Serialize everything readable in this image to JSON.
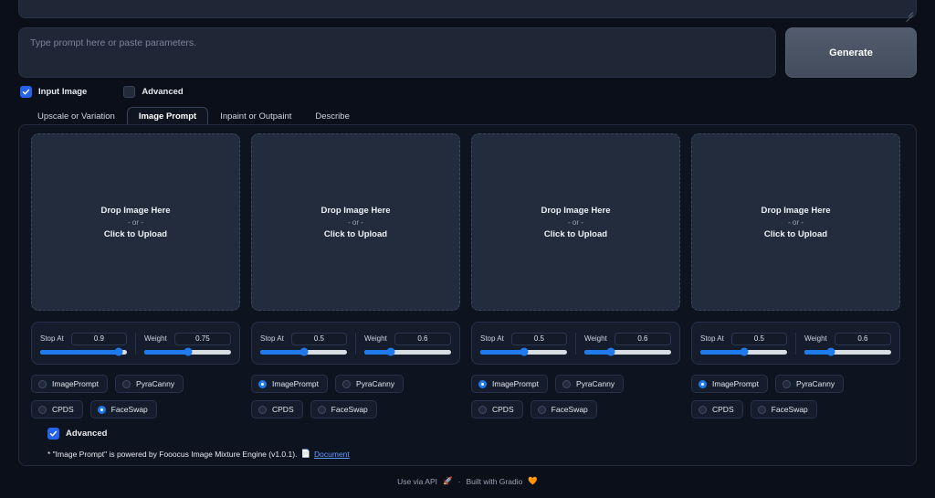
{
  "prompt": {
    "placeholder": "Type prompt here or paste parameters.",
    "value": ""
  },
  "generate_label": "Generate",
  "checkboxes": {
    "input_image": "Input Image",
    "advanced": "Advanced"
  },
  "tabs": [
    {
      "label": "Upscale or Variation",
      "active": false
    },
    {
      "label": "Image Prompt",
      "active": true
    },
    {
      "label": "Inpaint or Outpaint",
      "active": false
    },
    {
      "label": "Describe",
      "active": false
    }
  ],
  "dropzone": {
    "main": "Drop Image Here",
    "or": "- or -",
    "upload": "Click to Upload"
  },
  "slider_labels": {
    "stop_at": "Stop At",
    "weight": "Weight"
  },
  "radio_labels": {
    "image_prompt": "ImagePrompt",
    "pyra_canny": "PyraCanny",
    "cpds": "CPDS",
    "face_swap": "FaceSwap"
  },
  "columns": [
    {
      "stop_at": "0.9",
      "stop_at_pct": 90,
      "weight": "0.75",
      "weight_pct": 50,
      "selected": "FaceSwap"
    },
    {
      "stop_at": "0.5",
      "stop_at_pct": 50,
      "weight": "0.6",
      "weight_pct": 30,
      "selected": "ImagePrompt"
    },
    {
      "stop_at": "0.5",
      "stop_at_pct": 50,
      "weight": "0.6",
      "weight_pct": 30,
      "selected": "ImagePrompt"
    },
    {
      "stop_at": "0.5",
      "stop_at_pct": 50,
      "weight": "0.6",
      "weight_pct": 30,
      "selected": "ImagePrompt"
    }
  ],
  "panel_advanced_label": "Advanced",
  "panel_note": {
    "text": "* \"Image Prompt\" is powered by Fooocus Image Mixture Engine (v1.0.1).",
    "doc_icon": "page-icon",
    "doc_label": "Document"
  },
  "footer": {
    "api_label": "Use via API",
    "api_icon": "rocket-icon",
    "separator": "·",
    "gradio_label": "Built with Gradio",
    "gradio_icon": "heart-icon"
  },
  "colors": {
    "accent_blue": "#1f7aec",
    "check_blue": "#2563eb",
    "link_blue": "#5f9aff",
    "page_bg": "#0b0f19",
    "dropzone_bg": "#232c3d"
  }
}
